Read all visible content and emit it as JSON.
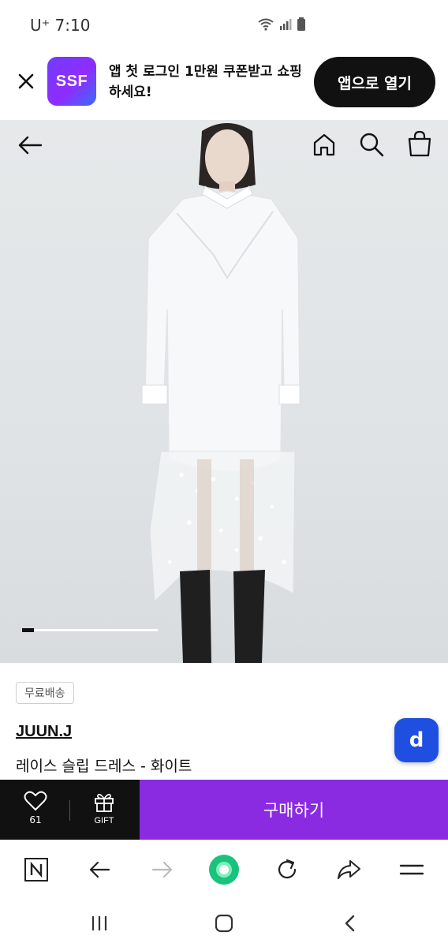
{
  "status_bar": {
    "carrier_time": "U⁺ 7:10",
    "icons": [
      "wifi-icon",
      "signal-icon",
      "battery-icon"
    ]
  },
  "app_banner": {
    "logo_text": "SSF",
    "message": "앱 첫 로그인 1만원 쿠폰받고 쇼핑하세요!",
    "open_button": "앱으로 열기"
  },
  "hero": {
    "nav_icons": [
      "back-arrow-icon",
      "home-icon",
      "search-icon",
      "shopping-bag-icon"
    ],
    "carousel_progress": 0.09
  },
  "product": {
    "shipping_badge": "무료배송",
    "brand": "JUUN.J",
    "name": "레이스 슬립 드레스 - 화이트",
    "floating_button": "d"
  },
  "buy_bar": {
    "like_count": "61",
    "gift_label": "GIFT",
    "purchase_label": "구매하기"
  },
  "browser_toolbar": {
    "icons": [
      "naver-n-icon",
      "back-icon",
      "forward-icon",
      "green-dot-icon",
      "reload-icon",
      "share-icon",
      "menu-icon"
    ]
  },
  "system_nav": {
    "icons": [
      "recent-apps-icon",
      "home-circle-icon",
      "system-back-icon"
    ]
  },
  "colors": {
    "purchase": "#8a2be2",
    "brand_gradient_start": "#6f3cff",
    "floating_button": "#1e4fe0",
    "green_dot": "#19c37d"
  }
}
